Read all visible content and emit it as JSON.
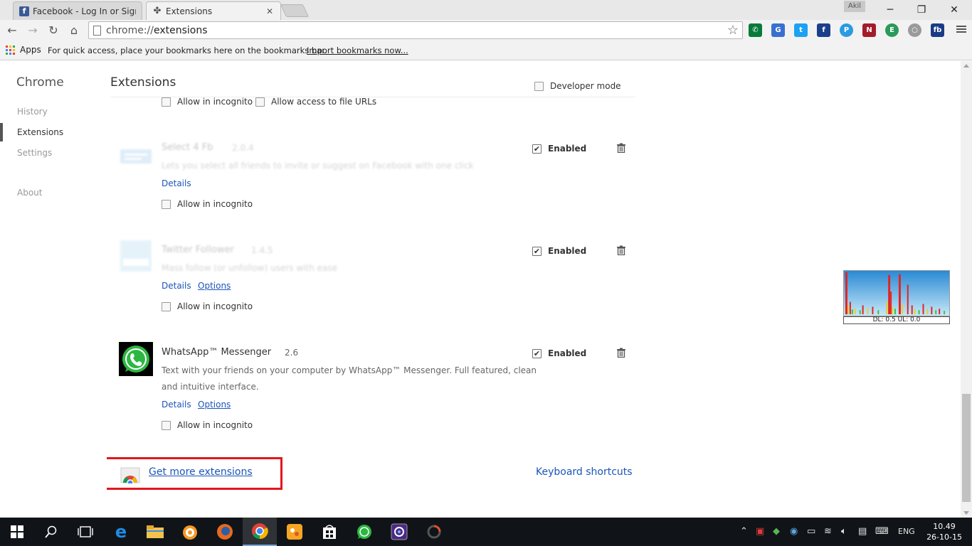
{
  "tabs": [
    {
      "title": "Facebook - Log In or Sign",
      "favicon": "facebook-icon"
    },
    {
      "title": "Extensions",
      "favicon": "puzzle-icon"
    }
  ],
  "window": {
    "profile": "Akil"
  },
  "toolbar": {
    "url_scheme": "chrome://",
    "url_path": "extensions",
    "extension_icons": [
      "whatsapp-icon",
      "google-translate-icon",
      "twitter-icon",
      "facebook-icon",
      "playstore-icon",
      "news-icon",
      "ghostery-icon",
      "chrome-icon",
      "fb-icon"
    ]
  },
  "bookmarks": {
    "apps_label": "Apps",
    "hint": "For quick access, place your bookmarks here on the bookmarks bar.",
    "import_link": "Import bookmarks now..."
  },
  "sidebar": {
    "brand": "Chrome",
    "items": [
      {
        "label": "History"
      },
      {
        "label": "Extensions"
      },
      {
        "label": "Settings"
      },
      {
        "label": "About"
      }
    ]
  },
  "page": {
    "title": "Extensions",
    "developer_mode": "Developer mode"
  },
  "top_options": {
    "incognito": "Allow in incognito",
    "file_urls": "Allow access to file URLs"
  },
  "extensions": [
    {
      "name": "Select 4 Fb",
      "version": "2.0.4",
      "description": "Lets you select all friends to invite or suggest on Facebook with one click",
      "details": "Details",
      "incognito": "Allow in incognito",
      "enabled": "Enabled"
    },
    {
      "name": "Twitter Follower",
      "version": "1.4.5",
      "description": "Mass follow (or unfollow) users with ease",
      "details": "Details",
      "options": "Options",
      "incognito": "Allow in incognito",
      "enabled": "Enabled"
    },
    {
      "name": "WhatsApp™ Messenger",
      "version": "2.6",
      "description_line1": "Text with your friends on your computer by WhatsApp™ Messenger. Full featured, clean",
      "description_line2": "and intuitive interface.",
      "details": "Details",
      "options": "Options",
      "incognito": "Allow in incognito",
      "enabled": "Enabled"
    }
  ],
  "footer": {
    "get_more": "Get more extensions",
    "keyboard_shortcuts": "Keyboard shortcuts"
  },
  "netmon": {
    "label": "DL: 0.5 UL: 0.0"
  },
  "taskbar": {
    "lang": "ENG",
    "time": "10.49",
    "date": "26-10-15"
  },
  "colors": {
    "link": "#1b55b8",
    "highlight_box": "#e4161e",
    "taskbar": "#101418"
  }
}
